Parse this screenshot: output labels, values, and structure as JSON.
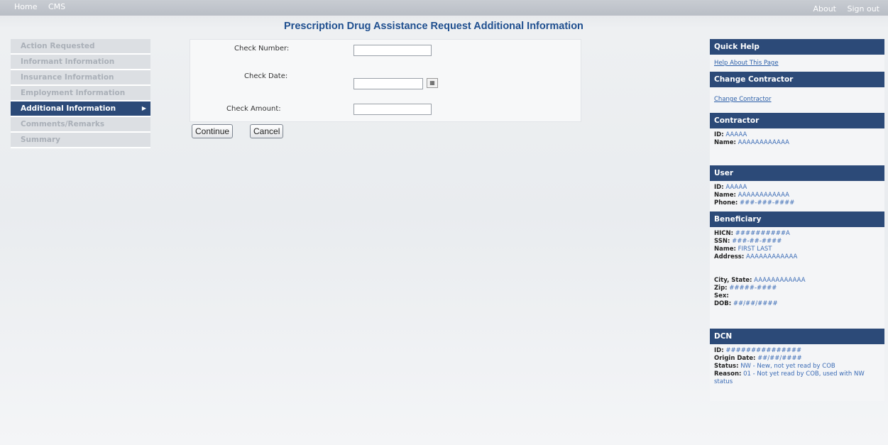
{
  "topbar": {
    "nav": [
      "Home",
      "CMS"
    ],
    "right": [
      "About",
      "Sign out"
    ]
  },
  "page_title": "Prescription Drug Assistance Request Additional Information",
  "sidebar": {
    "items": [
      {
        "label": "Action Requested"
      },
      {
        "label": "Informant Information"
      },
      {
        "label": "Insurance Information"
      },
      {
        "label": "Employment Information"
      },
      {
        "label": "Additional Information",
        "active": true
      },
      {
        "label": "Comments/Remarks"
      },
      {
        "label": "Summary"
      }
    ]
  },
  "form": {
    "check_number_label": "Check Number:",
    "check_number_value": "",
    "check_date_label": "Check Date:",
    "check_date_value": "",
    "check_amount_label": "Check Amount:",
    "check_amount_value": "",
    "continue_label": "Continue",
    "cancel_label": "Cancel"
  },
  "quick_help": {
    "title": "Quick Help",
    "link": "Help About This Page"
  },
  "change_contractor": {
    "title": "Change Contractor",
    "link": "Change Contractor"
  },
  "contractor": {
    "title": "Contractor",
    "id_label": "ID:",
    "id": "AAAAA",
    "name_label": "Name:",
    "name": "AAAAAAAAAAAA"
  },
  "user": {
    "title": "User",
    "id_label": "ID:",
    "id": "AAAAA",
    "name_label": "Name:",
    "name": "AAAAAAAAAAAA",
    "phone_label": "Phone:",
    "phone": "###-###-####"
  },
  "beneficiary": {
    "title": "Beneficiary",
    "hicn_label": "HICN:",
    "hicn": "##########A",
    "ssn_label": "SSN:",
    "ssn": "###-##-####",
    "name_label": "Name:",
    "name": "FIRST LAST",
    "address_label": "Address:",
    "address": "AAAAAAAAAAAA",
    "city_label": "City, State:",
    "city": "AAAAAAAAAAAA",
    "zip_label": "Zip:",
    "zip": "#####-####",
    "sex_label": "Sex:",
    "sex": "",
    "dob_label": "DOB:",
    "dob": "##/##/####"
  },
  "dcn": {
    "title": "DCN",
    "id_label": "ID:",
    "id": "###############",
    "origin_label": "Origin Date:",
    "origin": "##/##/####",
    "status_label": "Status:",
    "status": "NW - New, not yet read by COB",
    "reason_label": "Reason:",
    "reason": "01 - Not yet read by COB, used with NW status"
  }
}
